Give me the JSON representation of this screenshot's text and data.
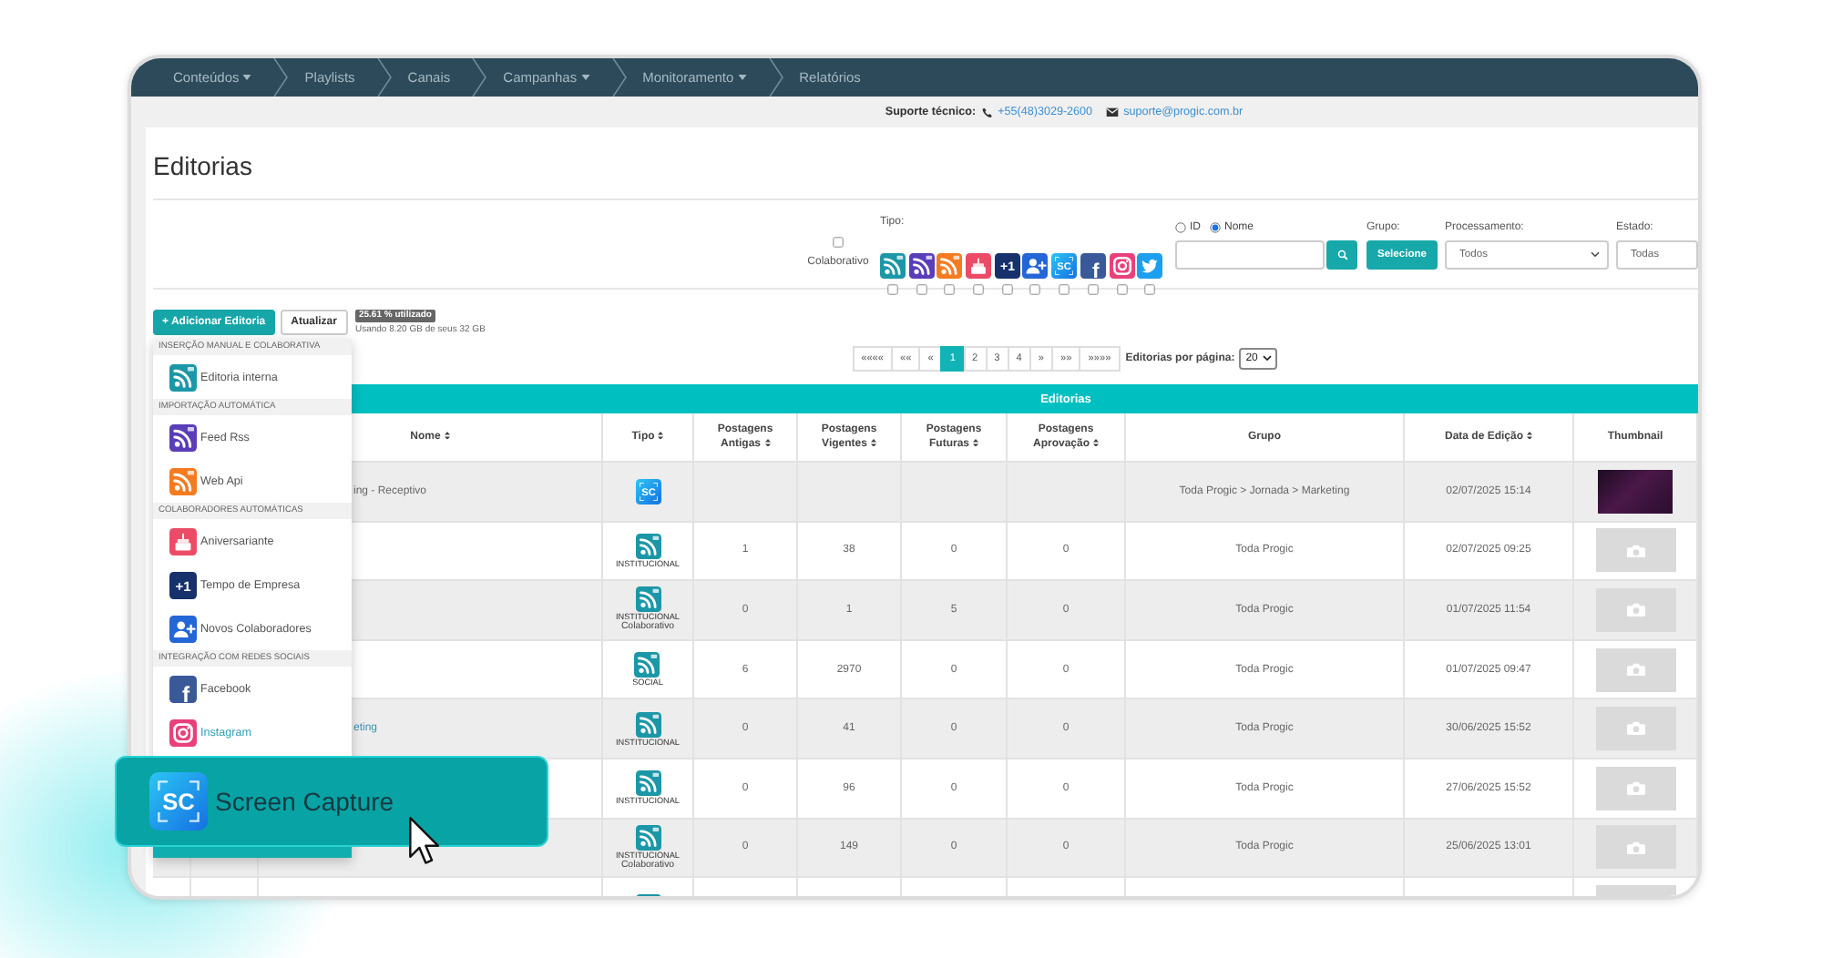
{
  "nav": {
    "items": [
      {
        "label": "Conteúdos",
        "dropdown": true
      },
      {
        "label": "Playlists",
        "dropdown": false
      },
      {
        "label": "Canais",
        "dropdown": false
      },
      {
        "label": "Campanhas",
        "dropdown": true
      },
      {
        "label": "Monitoramento",
        "dropdown": true
      },
      {
        "label": "Relatórios",
        "dropdown": false
      }
    ]
  },
  "support": {
    "label": "Suporte técnico:",
    "phone": "+55(48)3029-2600",
    "email": "suporte@progic.com.br"
  },
  "page_title": "Editorias",
  "filters": {
    "colaborativo": {
      "label": "Colaborativo",
      "checked": false
    },
    "tipo": {
      "label": "Tipo:",
      "types": [
        {
          "kind": "interna",
          "checked": false
        },
        {
          "kind": "feed_rss",
          "checked": false
        },
        {
          "kind": "web_api",
          "checked": false
        },
        {
          "kind": "aniversariante",
          "checked": false
        },
        {
          "kind": "tempo_empresa",
          "glyph": "+1",
          "checked": false
        },
        {
          "kind": "novos_colaboradores",
          "checked": false
        },
        {
          "kind": "screen_capture",
          "glyph": "SC",
          "checked": false
        },
        {
          "kind": "facebook",
          "glyph": "f",
          "checked": false
        },
        {
          "kind": "instagram",
          "checked": false
        },
        {
          "kind": "twitter",
          "checked": false
        }
      ]
    },
    "search_by": [
      {
        "label": "ID",
        "selected": false
      },
      {
        "label": "Nome",
        "selected": true
      }
    ],
    "grupo": {
      "label": "Grupo:",
      "button": "Selecione"
    },
    "processamento": {
      "label": "Processamento:",
      "value": "Todos"
    },
    "estado": {
      "label": "Estado:",
      "value": "Todas"
    }
  },
  "toolbar": {
    "add_button": "+ Adicionar Editoria",
    "refresh_button": "Atualizar",
    "storage": {
      "badge": "25.61 % utilizado",
      "usage": "Usando 8.20 GB de seus 32 GB"
    }
  },
  "add_menu": {
    "sections": [
      {
        "title": "INSERÇÃO MANUAL E COLABORATIVA",
        "items": [
          {
            "label": "Editoria interna",
            "kind": "interna",
            "highlighted": false
          }
        ]
      },
      {
        "title": "IMPORTAÇÃO AUTOMÁTICA",
        "items": [
          {
            "label": "Feed Rss",
            "kind": "feed_rss",
            "highlighted": false
          },
          {
            "label": "Web Api",
            "kind": "web_api",
            "highlighted": false
          }
        ]
      },
      {
        "title": "COLABORADORES AUTOMÁTICAS",
        "items": [
          {
            "label": "Aniversariante",
            "kind": "aniversariante",
            "highlighted": false
          },
          {
            "label": "Tempo de Empresa",
            "kind": "tempo_empresa",
            "glyph": "+1",
            "highlighted": false
          },
          {
            "label": "Novos Colaboradores",
            "kind": "novos_colaboradores",
            "highlighted": false
          }
        ]
      },
      {
        "title": "INTEGRAÇÃO COM REDES SOCIAIS",
        "items": [
          {
            "label": "Facebook",
            "kind": "facebook",
            "glyph": "f",
            "highlighted": false
          },
          {
            "label": "Instagram",
            "kind": "instagram",
            "highlighted": true
          }
        ]
      }
    ]
  },
  "callout": {
    "label": "Screen Capture",
    "kind": "screen_capture",
    "glyph": "SC",
    "selected": true
  },
  "pagination": {
    "pages": [
      {
        "label": "««««",
        "selected": false
      },
      {
        "label": "««",
        "selected": false
      },
      {
        "label": "«",
        "selected": false
      },
      {
        "label": "1",
        "selected": true
      },
      {
        "label": "2",
        "selected": false
      },
      {
        "label": "3",
        "selected": false
      },
      {
        "label": "4",
        "selected": false
      },
      {
        "label": "»",
        "selected": false
      },
      {
        "label": "»»",
        "selected": false
      },
      {
        "label": "»»»»",
        "selected": false
      }
    ],
    "per_page_label": "Editorias por página:",
    "per_page": "20"
  },
  "table": {
    "title": "Editorias",
    "columns": [
      {
        "label": "Nome",
        "sortable": true
      },
      {
        "label": "Tipo",
        "sortable": true
      },
      {
        "label": "Postagens Antigas",
        "sortable": true
      },
      {
        "label": "Postagens Vigentes",
        "sortable": true
      },
      {
        "label": "Postagens Futuras",
        "sortable": true
      },
      {
        "label": "Postagens Aprovação",
        "sortable": true
      },
      {
        "label": "Grupo",
        "sortable": false
      },
      {
        "label": "Data de Edição",
        "sortable": true
      },
      {
        "label": "Thumbnail",
        "sortable": false
      }
    ],
    "rows": [
      {
        "nome": "ing - Receptivo",
        "link": false,
        "tipo": {
          "kind": "screen_capture",
          "glyph": "SC"
        },
        "grupo": "Toda Progic > Jornada > Marketing",
        "data": "02/07/2025 15:14",
        "thumbnail": {
          "kind": "photo"
        }
      },
      {
        "tipo": {
          "kind": "rss",
          "tag": "INSTITUCIONAL"
        },
        "antigas": "1",
        "vigentes": "38",
        "futuras": "0",
        "aprovacao": "0",
        "grupo": "Toda Progic",
        "data": "02/07/2025 09:25",
        "thumbnail": {
          "kind": "empty"
        }
      },
      {
        "tipo": {
          "kind": "rss",
          "tag": "INSTITUCIONAL",
          "note": "Colaborativo"
        },
        "antigas": "0",
        "vigentes": "1",
        "futuras": "5",
        "aprovacao": "0",
        "grupo": "Toda Progic",
        "data": "01/07/2025 11:54",
        "thumbnail": {
          "kind": "empty"
        }
      },
      {
        "tipo": {
          "kind": "rss",
          "tag": "SOCIAL"
        },
        "antigas": "6",
        "vigentes": "2970",
        "futuras": "0",
        "aprovacao": "0",
        "grupo": "Toda Progic",
        "data": "01/07/2025 09:47",
        "thumbnail": {
          "kind": "empty"
        }
      },
      {
        "nome": "eting",
        "link": true,
        "tipo": {
          "kind": "rss",
          "tag": "INSTITUCIONAL"
        },
        "antigas": "0",
        "vigentes": "41",
        "futuras": "0",
        "aprovacao": "0",
        "grupo": "Toda Progic",
        "data": "30/06/2025 15:52",
        "thumbnail": {
          "kind": "empty"
        }
      },
      {
        "tipo": {
          "kind": "rss",
          "tag": "INSTITUCIONAL"
        },
        "antigas": "0",
        "vigentes": "96",
        "futuras": "0",
        "aprovacao": "0",
        "grupo": "Toda Progic",
        "data": "27/06/2025 15:52",
        "thumbnail": {
          "kind": "empty"
        }
      },
      {
        "tipo": {
          "kind": "rss",
          "tag": "INSTITUCIONAL",
          "note": "Colaborativo"
        },
        "antigas": "0",
        "vigentes": "149",
        "futuras": "0",
        "aprovacao": "0",
        "grupo": "Toda Progic",
        "data": "25/06/2025 13:01",
        "thumbnail": {
          "kind": "empty"
        }
      },
      {
        "tipo": {
          "kind": "rss"
        },
        "thumbnail": {
          "kind": "empty"
        }
      }
    ]
  }
}
